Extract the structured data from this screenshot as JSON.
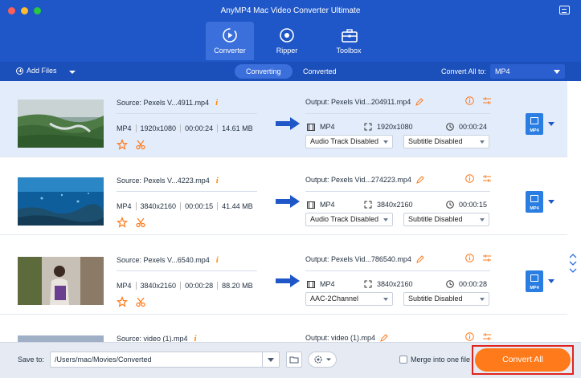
{
  "app": {
    "title": "AnyMP4 Mac Video Converter Ultimate"
  },
  "main_tabs": [
    {
      "label": "Converter",
      "icon": "converter-icon",
      "active": true
    },
    {
      "label": "Ripper",
      "icon": "ripper-disc-icon",
      "active": false
    },
    {
      "label": "Toolbox",
      "icon": "toolbox-icon",
      "active": false
    }
  ],
  "toolbar": {
    "add_files": "Add Files",
    "tabs": [
      {
        "label": "Converting",
        "active": true
      },
      {
        "label": "Converted",
        "active": false
      }
    ],
    "convert_all_label": "Convert All to:",
    "convert_all_value": "MP4"
  },
  "files": [
    {
      "source": "Source: Pexels V...4911.mp4",
      "format": "MP4",
      "resolution": "1920x1080",
      "duration": "00:00:24",
      "size": "14.61 MB",
      "output": "Output: Pexels Vid...204911.mp4",
      "out_format": "MP4",
      "out_resolution": "1920x1080",
      "out_duration": "00:00:24",
      "audio": "Audio Track Disabled",
      "subtitle": "Subtitle Disabled",
      "badge": "MP4",
      "thumb": "aerial-green-hills"
    },
    {
      "source": "Source: Pexels V...4223.mp4",
      "format": "MP4",
      "resolution": "3840x2160",
      "duration": "00:00:15",
      "size": "41.44 MB",
      "output": "Output: Pexels Vid...274223.mp4",
      "out_format": "MP4",
      "out_resolution": "3840x2160",
      "out_duration": "00:00:15",
      "audio": "Audio Track Disabled",
      "subtitle": "Subtitle Disabled",
      "badge": "MP4",
      "thumb": "underwater-reef"
    },
    {
      "source": "Source: Pexels V...6540.mp4",
      "format": "MP4",
      "resolution": "3840x2160",
      "duration": "00:00:28",
      "size": "88.20 MB",
      "output": "Output: Pexels Vid...786540.mp4",
      "out_format": "MP4",
      "out_resolution": "3840x2160",
      "out_duration": "00:00:28",
      "audio": "AAC-2Channel",
      "subtitle": "Subtitle Disabled",
      "badge": "MP4",
      "thumb": "woman-with-yoga-mat"
    },
    {
      "source": "Source: video (1).mp4",
      "output": "Output: video (1).mp4",
      "thumb": "partial-landscape"
    }
  ],
  "bottom": {
    "save_to_label": "Save to:",
    "save_path": "/Users/mac/Movies/Converted",
    "merge_label": "Merge into one file",
    "merge_checked": false,
    "convert_all_button": "Convert All"
  },
  "colors": {
    "header": "#1f57c8",
    "toolbar": "#1b4fb9",
    "accent_orange": "#ff7a1a",
    "highlight_red": "#e0231e",
    "selected_row": "#e3ecfb"
  }
}
